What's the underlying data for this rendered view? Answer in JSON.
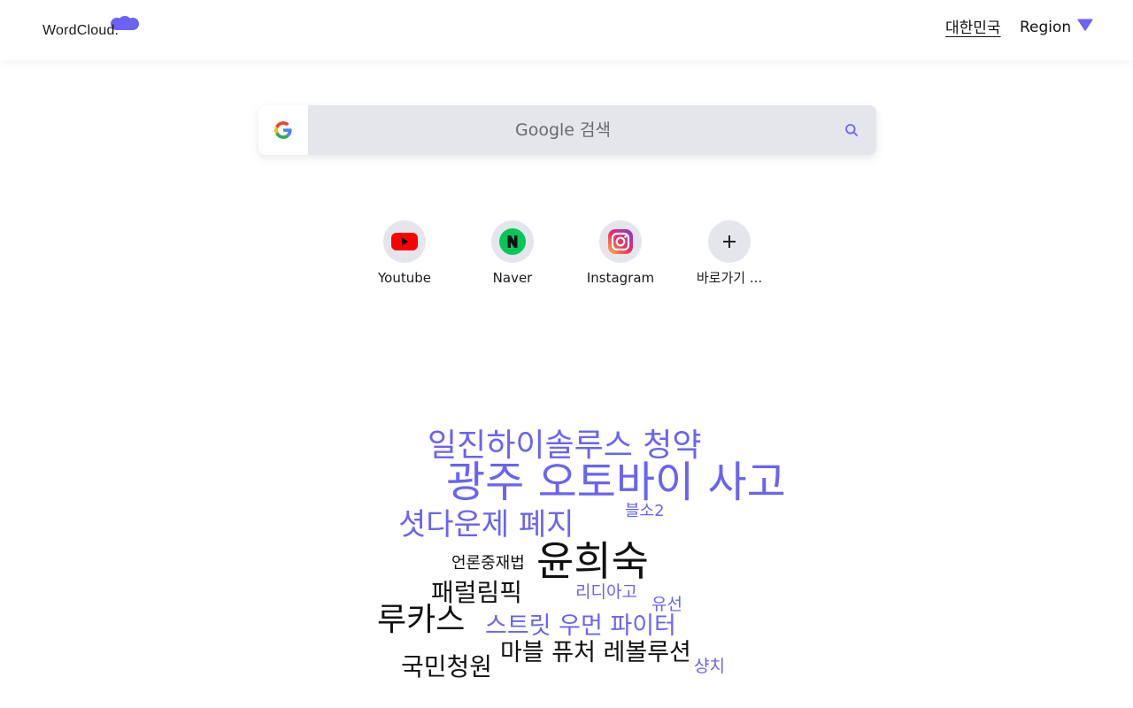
{
  "header": {
    "logo_text": "WordCloud.",
    "country_link": "대한민국",
    "region_label": "Region",
    "accent_color": "#6a63f6"
  },
  "search": {
    "placeholder": "Google 검색",
    "engine_icon": "google-g-icon",
    "search_icon": "magnifier-icon"
  },
  "shortcuts": [
    {
      "label": "Youtube",
      "icon": "youtube-icon"
    },
    {
      "label": "Naver",
      "icon": "naver-icon"
    },
    {
      "label": "Instagram",
      "icon": "instagram-icon"
    },
    {
      "label": "바로가기 ...",
      "icon": "plus-icon"
    }
  ],
  "wordcloud": {
    "colors": {
      "primary": "#6a63f6",
      "secondary": "#111111"
    },
    "words": [
      {
        "text": "일진하이솔루스 청약",
        "color": "primary"
      },
      {
        "text": "광주 오토바이 사고",
        "color": "primary"
      },
      {
        "text": "셧다운제 폐지",
        "color": "primary"
      },
      {
        "text": "블소2",
        "color": "primary"
      },
      {
        "text": "언론중재법",
        "color": "secondary"
      },
      {
        "text": "윤희숙",
        "color": "secondary"
      },
      {
        "text": "패럴림픽",
        "color": "secondary"
      },
      {
        "text": "리디아고",
        "color": "primary"
      },
      {
        "text": "유선",
        "color": "primary"
      },
      {
        "text": "루카스",
        "color": "secondary"
      },
      {
        "text": "스트릿 우먼 파이터",
        "color": "primary"
      },
      {
        "text": "마블 퓨처 레볼루션",
        "color": "secondary"
      },
      {
        "text": "국민청원",
        "color": "secondary"
      },
      {
        "text": "샹치",
        "color": "primary"
      }
    ]
  }
}
